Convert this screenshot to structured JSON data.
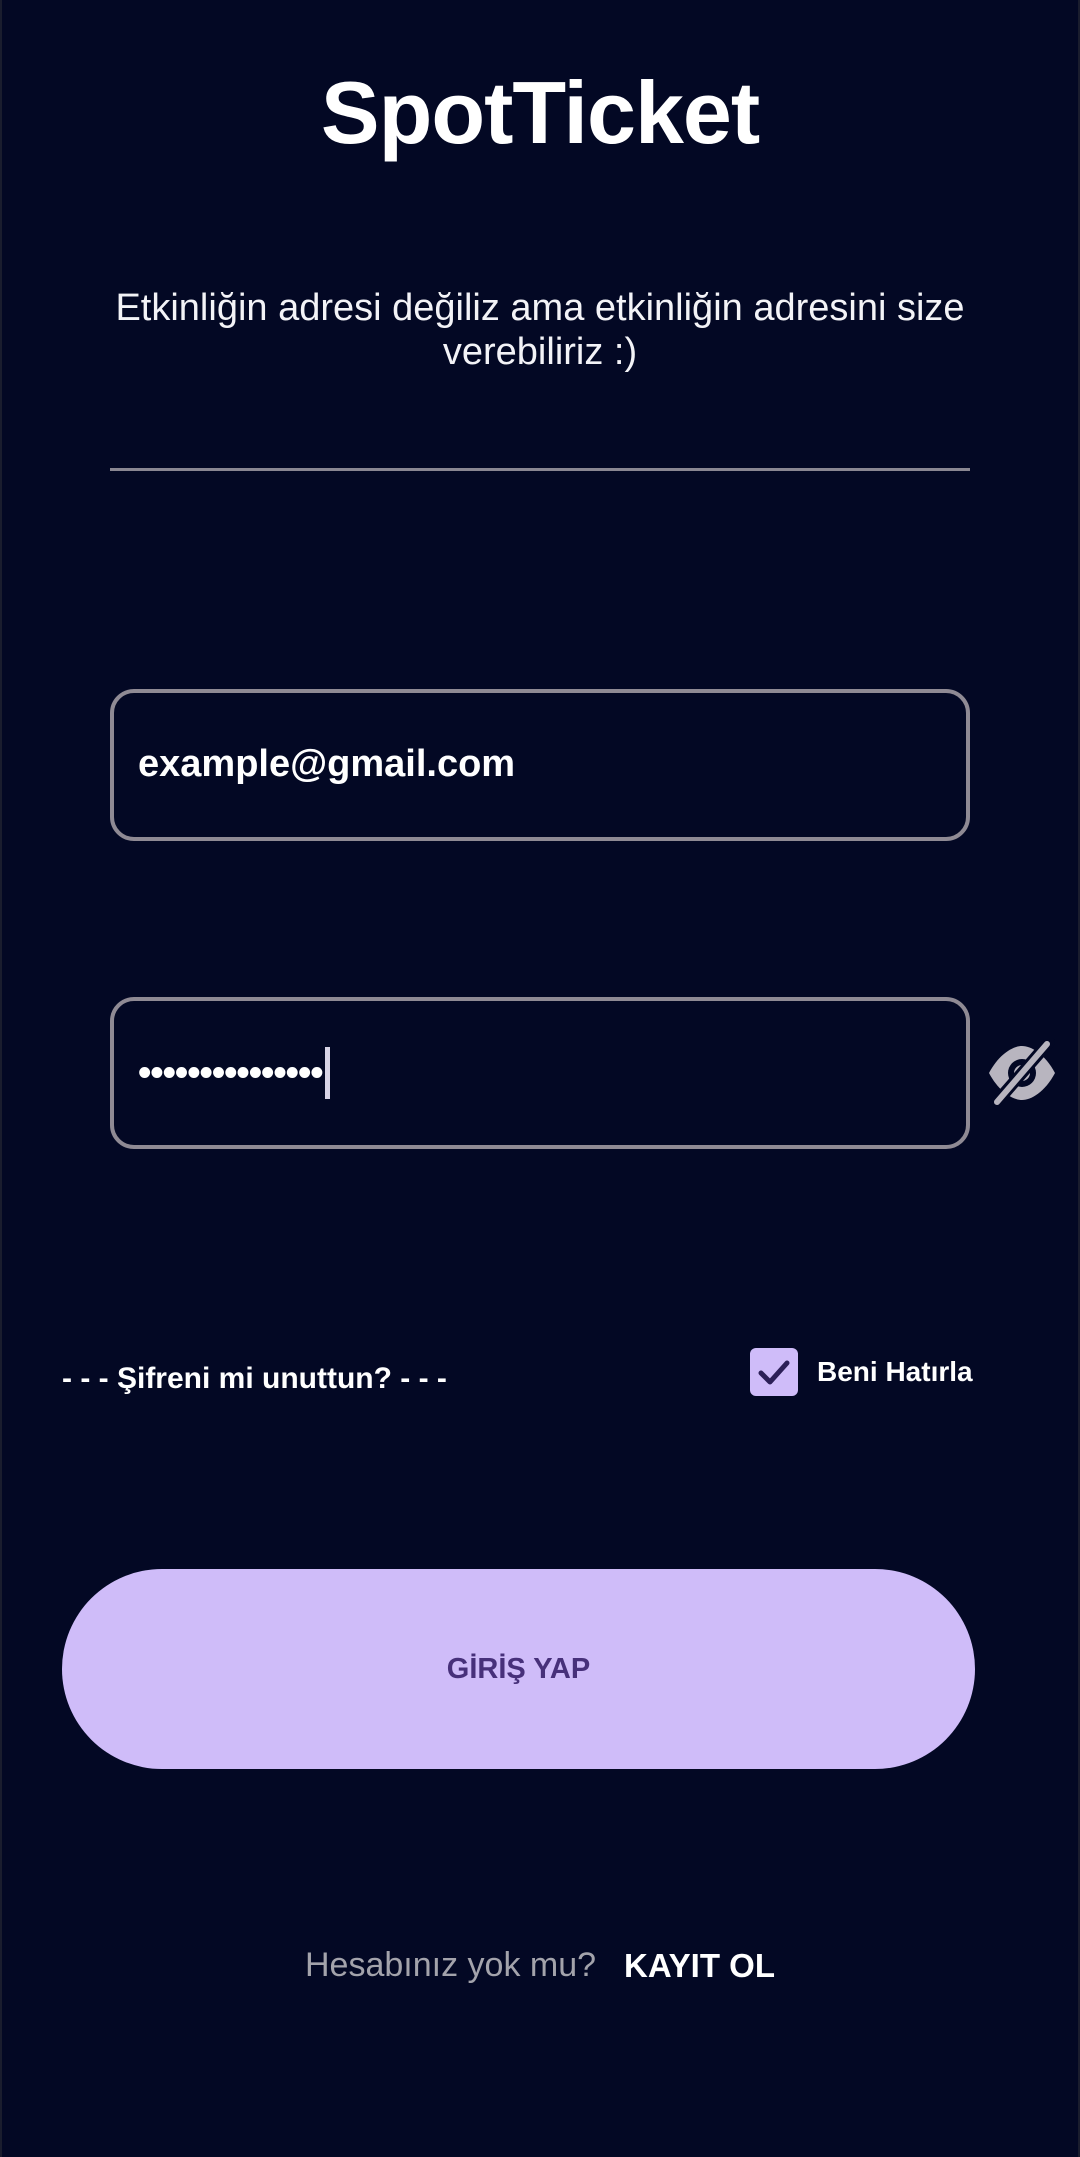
{
  "app": {
    "title": "SpotTicket",
    "subtitle": "Etkinliğin adresi değiliz ama etkinliğin adresini size verebiliriz :)"
  },
  "form": {
    "email_value": "example@gmail.com",
    "password_masked": "•••••••••••••••",
    "password_toggle_icon": "eye-off-icon",
    "forgot_password": "- - - Şifreni mi unuttun? - - -",
    "remember_me_label": "Beni Hatırla",
    "remember_me_checked": true,
    "login_button": "GİRİŞ YAP"
  },
  "footer": {
    "question": "Hesabınız yok mu?",
    "register_link": "KAYIT OL"
  },
  "colors": {
    "background": "#030824",
    "accent": "#cfbcf9",
    "button_text": "#47307a",
    "field_border": "#8f8a94"
  }
}
